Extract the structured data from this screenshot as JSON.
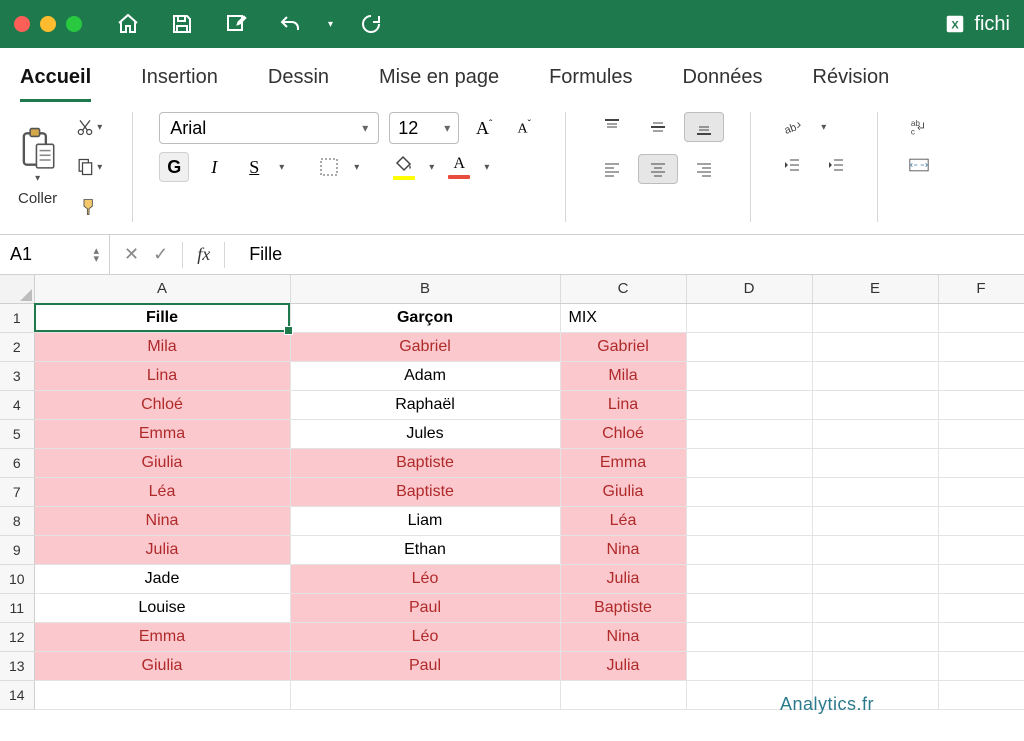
{
  "window": {
    "filename": "fichi"
  },
  "ribbon": {
    "tabs": [
      "Accueil",
      "Insertion",
      "Dessin",
      "Mise en page",
      "Formules",
      "Données",
      "Révision"
    ],
    "active_tab": 0,
    "paste_label": "Coller",
    "font_name": "Arial",
    "font_size": "12",
    "bold_label": "G",
    "italic_label": "I",
    "underline_label": "S"
  },
  "formula_bar": {
    "cell_ref": "A1",
    "fx_label": "fx",
    "value": "Fille"
  },
  "sheet": {
    "columns": [
      "A",
      "B",
      "C",
      "D",
      "E",
      "F"
    ],
    "rows": [
      {
        "n": "1",
        "cells": [
          {
            "v": "Fille",
            "hl": false,
            "b": true
          },
          {
            "v": "Garçon",
            "hl": false,
            "b": true
          },
          {
            "v": "MIX",
            "hl": false,
            "b": false,
            "align": "left"
          },
          {
            "v": ""
          },
          {
            "v": ""
          },
          {
            "v": ""
          }
        ]
      },
      {
        "n": "2",
        "cells": [
          {
            "v": "Mila",
            "hl": true
          },
          {
            "v": "Gabriel",
            "hl": true
          },
          {
            "v": "Gabriel",
            "hl": true
          },
          {
            "v": ""
          },
          {
            "v": ""
          },
          {
            "v": ""
          }
        ]
      },
      {
        "n": "3",
        "cells": [
          {
            "v": "Lina",
            "hl": true
          },
          {
            "v": "Adam",
            "hl": false
          },
          {
            "v": "Mila",
            "hl": true
          },
          {
            "v": ""
          },
          {
            "v": ""
          },
          {
            "v": ""
          }
        ]
      },
      {
        "n": "4",
        "cells": [
          {
            "v": "Chloé",
            "hl": true
          },
          {
            "v": "Raphaël",
            "hl": false
          },
          {
            "v": "Lina",
            "hl": true
          },
          {
            "v": ""
          },
          {
            "v": ""
          },
          {
            "v": ""
          }
        ]
      },
      {
        "n": "5",
        "cells": [
          {
            "v": "Emma",
            "hl": true
          },
          {
            "v": "Jules",
            "hl": false
          },
          {
            "v": "Chloé",
            "hl": true
          },
          {
            "v": ""
          },
          {
            "v": ""
          },
          {
            "v": ""
          }
        ]
      },
      {
        "n": "6",
        "cells": [
          {
            "v": "Giulia",
            "hl": true
          },
          {
            "v": "Baptiste",
            "hl": true
          },
          {
            "v": "Emma",
            "hl": true
          },
          {
            "v": ""
          },
          {
            "v": ""
          },
          {
            "v": ""
          }
        ]
      },
      {
        "n": "7",
        "cells": [
          {
            "v": "Léa",
            "hl": true
          },
          {
            "v": "Baptiste",
            "hl": true
          },
          {
            "v": "Giulia",
            "hl": true
          },
          {
            "v": ""
          },
          {
            "v": ""
          },
          {
            "v": ""
          }
        ]
      },
      {
        "n": "8",
        "cells": [
          {
            "v": "Nina",
            "hl": true
          },
          {
            "v": "Liam",
            "hl": false
          },
          {
            "v": "Léa",
            "hl": true
          },
          {
            "v": ""
          },
          {
            "v": ""
          },
          {
            "v": ""
          }
        ]
      },
      {
        "n": "9",
        "cells": [
          {
            "v": "Julia",
            "hl": true
          },
          {
            "v": "Ethan",
            "hl": false
          },
          {
            "v": "Nina",
            "hl": true
          },
          {
            "v": ""
          },
          {
            "v": ""
          },
          {
            "v": ""
          }
        ]
      },
      {
        "n": "10",
        "cells": [
          {
            "v": "Jade",
            "hl": false
          },
          {
            "v": "Léo",
            "hl": true
          },
          {
            "v": "Julia",
            "hl": true
          },
          {
            "v": ""
          },
          {
            "v": ""
          },
          {
            "v": ""
          }
        ]
      },
      {
        "n": "11",
        "cells": [
          {
            "v": "Louise",
            "hl": false
          },
          {
            "v": "Paul",
            "hl": true
          },
          {
            "v": "Baptiste",
            "hl": true
          },
          {
            "v": ""
          },
          {
            "v": ""
          },
          {
            "v": ""
          }
        ]
      },
      {
        "n": "12",
        "cells": [
          {
            "v": "Emma",
            "hl": true
          },
          {
            "v": "Léo",
            "hl": true
          },
          {
            "v": "Nina",
            "hl": true
          },
          {
            "v": ""
          },
          {
            "v": ""
          },
          {
            "v": ""
          }
        ]
      },
      {
        "n": "13",
        "cells": [
          {
            "v": "Giulia",
            "hl": true
          },
          {
            "v": "Paul",
            "hl": true
          },
          {
            "v": "Julia",
            "hl": true
          },
          {
            "v": ""
          },
          {
            "v": ""
          },
          {
            "v": ""
          }
        ]
      },
      {
        "n": "14",
        "cells": [
          {
            "v": ""
          },
          {
            "v": ""
          },
          {
            "v": ""
          },
          {
            "v": ""
          },
          {
            "v": ""
          },
          {
            "v": ""
          }
        ]
      }
    ],
    "selected": "A1"
  },
  "watermark": "Analytics.fr"
}
